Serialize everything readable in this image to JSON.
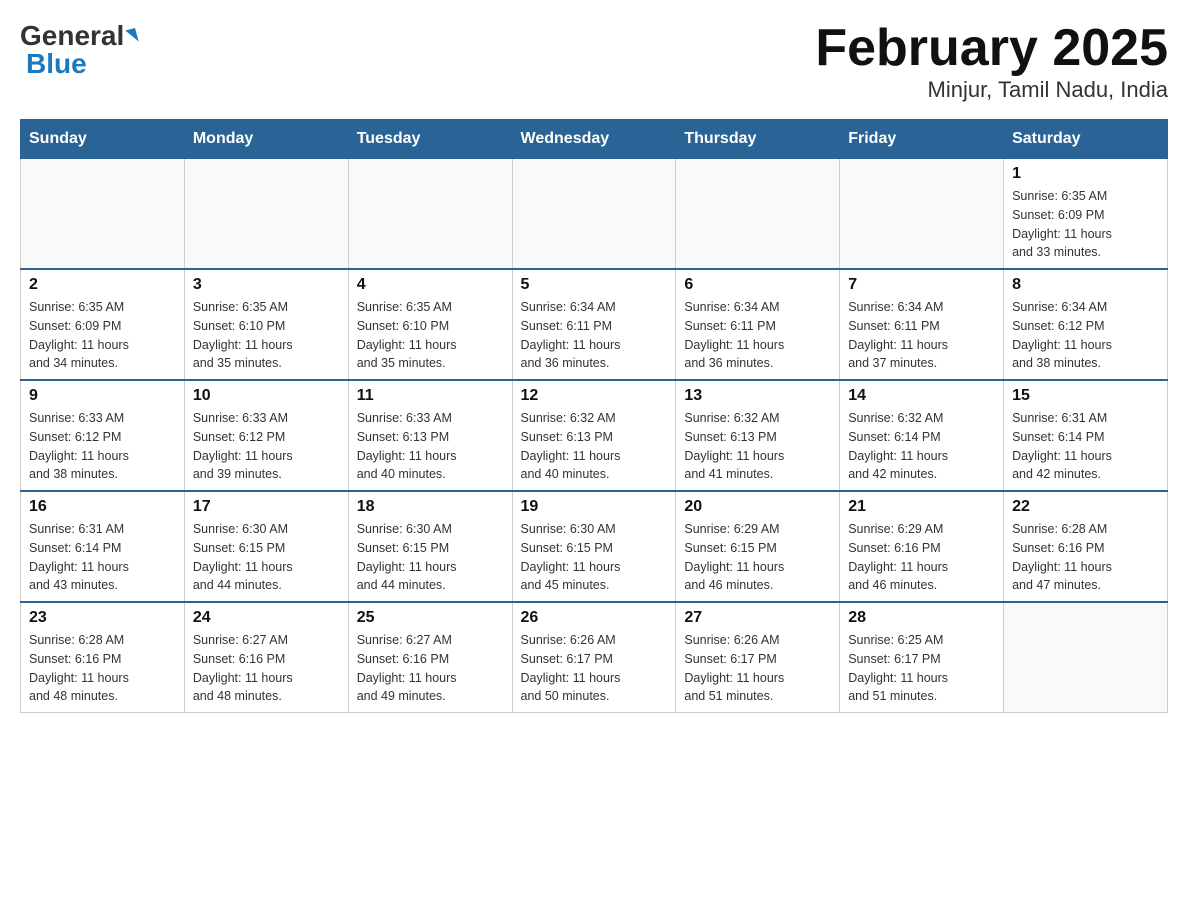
{
  "header": {
    "logo_general": "General",
    "logo_blue": "Blue",
    "title": "February 2025",
    "subtitle": "Minjur, Tamil Nadu, India"
  },
  "weekdays": [
    "Sunday",
    "Monday",
    "Tuesday",
    "Wednesday",
    "Thursday",
    "Friday",
    "Saturday"
  ],
  "weeks": [
    [
      {
        "day": "",
        "info": ""
      },
      {
        "day": "",
        "info": ""
      },
      {
        "day": "",
        "info": ""
      },
      {
        "day": "",
        "info": ""
      },
      {
        "day": "",
        "info": ""
      },
      {
        "day": "",
        "info": ""
      },
      {
        "day": "1",
        "info": "Sunrise: 6:35 AM\nSunset: 6:09 PM\nDaylight: 11 hours\nand 33 minutes."
      }
    ],
    [
      {
        "day": "2",
        "info": "Sunrise: 6:35 AM\nSunset: 6:09 PM\nDaylight: 11 hours\nand 34 minutes."
      },
      {
        "day": "3",
        "info": "Sunrise: 6:35 AM\nSunset: 6:10 PM\nDaylight: 11 hours\nand 35 minutes."
      },
      {
        "day": "4",
        "info": "Sunrise: 6:35 AM\nSunset: 6:10 PM\nDaylight: 11 hours\nand 35 minutes."
      },
      {
        "day": "5",
        "info": "Sunrise: 6:34 AM\nSunset: 6:11 PM\nDaylight: 11 hours\nand 36 minutes."
      },
      {
        "day": "6",
        "info": "Sunrise: 6:34 AM\nSunset: 6:11 PM\nDaylight: 11 hours\nand 36 minutes."
      },
      {
        "day": "7",
        "info": "Sunrise: 6:34 AM\nSunset: 6:11 PM\nDaylight: 11 hours\nand 37 minutes."
      },
      {
        "day": "8",
        "info": "Sunrise: 6:34 AM\nSunset: 6:12 PM\nDaylight: 11 hours\nand 38 minutes."
      }
    ],
    [
      {
        "day": "9",
        "info": "Sunrise: 6:33 AM\nSunset: 6:12 PM\nDaylight: 11 hours\nand 38 minutes."
      },
      {
        "day": "10",
        "info": "Sunrise: 6:33 AM\nSunset: 6:12 PM\nDaylight: 11 hours\nand 39 minutes."
      },
      {
        "day": "11",
        "info": "Sunrise: 6:33 AM\nSunset: 6:13 PM\nDaylight: 11 hours\nand 40 minutes."
      },
      {
        "day": "12",
        "info": "Sunrise: 6:32 AM\nSunset: 6:13 PM\nDaylight: 11 hours\nand 40 minutes."
      },
      {
        "day": "13",
        "info": "Sunrise: 6:32 AM\nSunset: 6:13 PM\nDaylight: 11 hours\nand 41 minutes."
      },
      {
        "day": "14",
        "info": "Sunrise: 6:32 AM\nSunset: 6:14 PM\nDaylight: 11 hours\nand 42 minutes."
      },
      {
        "day": "15",
        "info": "Sunrise: 6:31 AM\nSunset: 6:14 PM\nDaylight: 11 hours\nand 42 minutes."
      }
    ],
    [
      {
        "day": "16",
        "info": "Sunrise: 6:31 AM\nSunset: 6:14 PM\nDaylight: 11 hours\nand 43 minutes."
      },
      {
        "day": "17",
        "info": "Sunrise: 6:30 AM\nSunset: 6:15 PM\nDaylight: 11 hours\nand 44 minutes."
      },
      {
        "day": "18",
        "info": "Sunrise: 6:30 AM\nSunset: 6:15 PM\nDaylight: 11 hours\nand 44 minutes."
      },
      {
        "day": "19",
        "info": "Sunrise: 6:30 AM\nSunset: 6:15 PM\nDaylight: 11 hours\nand 45 minutes."
      },
      {
        "day": "20",
        "info": "Sunrise: 6:29 AM\nSunset: 6:15 PM\nDaylight: 11 hours\nand 46 minutes."
      },
      {
        "day": "21",
        "info": "Sunrise: 6:29 AM\nSunset: 6:16 PM\nDaylight: 11 hours\nand 46 minutes."
      },
      {
        "day": "22",
        "info": "Sunrise: 6:28 AM\nSunset: 6:16 PM\nDaylight: 11 hours\nand 47 minutes."
      }
    ],
    [
      {
        "day": "23",
        "info": "Sunrise: 6:28 AM\nSunset: 6:16 PM\nDaylight: 11 hours\nand 48 minutes."
      },
      {
        "day": "24",
        "info": "Sunrise: 6:27 AM\nSunset: 6:16 PM\nDaylight: 11 hours\nand 48 minutes."
      },
      {
        "day": "25",
        "info": "Sunrise: 6:27 AM\nSunset: 6:16 PM\nDaylight: 11 hours\nand 49 minutes."
      },
      {
        "day": "26",
        "info": "Sunrise: 6:26 AM\nSunset: 6:17 PM\nDaylight: 11 hours\nand 50 minutes."
      },
      {
        "day": "27",
        "info": "Sunrise: 6:26 AM\nSunset: 6:17 PM\nDaylight: 11 hours\nand 51 minutes."
      },
      {
        "day": "28",
        "info": "Sunrise: 6:25 AM\nSunset: 6:17 PM\nDaylight: 11 hours\nand 51 minutes."
      },
      {
        "day": "",
        "info": ""
      }
    ]
  ]
}
